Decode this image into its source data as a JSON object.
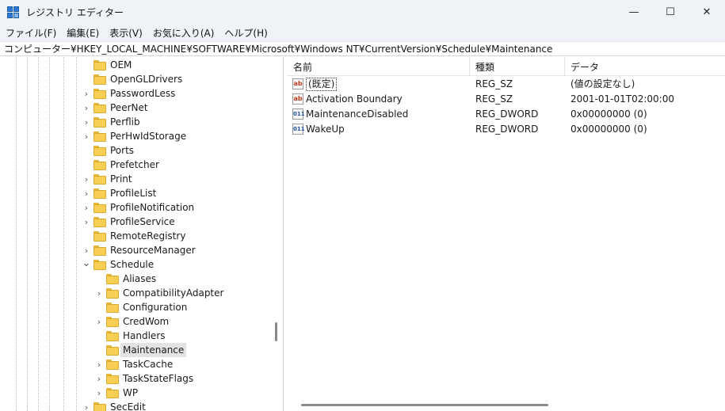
{
  "window": {
    "title": "レジストリ エディター",
    "controls": {
      "minimize": "—",
      "maximize": "☐",
      "close": "✕"
    }
  },
  "menu": [
    "ファイル(F)",
    "編集(E)",
    "表示(V)",
    "お気に入り(A)",
    "ヘルプ(H)"
  ],
  "address": "コンピューター¥HKEY_LOCAL_MACHINE¥SOFTWARE¥Microsoft¥Windows NT¥CurrentVersion¥Schedule¥Maintenance",
  "tree": [
    {
      "label": "OEM",
      "level": 0,
      "chevron": "none"
    },
    {
      "label": "OpenGLDrivers",
      "level": 0,
      "chevron": "none"
    },
    {
      "label": "PasswordLess",
      "level": 0,
      "chevron": "right"
    },
    {
      "label": "PeerNet",
      "level": 0,
      "chevron": "right"
    },
    {
      "label": "Perflib",
      "level": 0,
      "chevron": "right"
    },
    {
      "label": "PerHwIdStorage",
      "level": 0,
      "chevron": "right"
    },
    {
      "label": "Ports",
      "level": 0,
      "chevron": "none"
    },
    {
      "label": "Prefetcher",
      "level": 0,
      "chevron": "none"
    },
    {
      "label": "Print",
      "level": 0,
      "chevron": "right"
    },
    {
      "label": "ProfileList",
      "level": 0,
      "chevron": "right"
    },
    {
      "label": "ProfileNotification",
      "level": 0,
      "chevron": "right"
    },
    {
      "label": "ProfileService",
      "level": 0,
      "chevron": "right"
    },
    {
      "label": "RemoteRegistry",
      "level": 0,
      "chevron": "none"
    },
    {
      "label": "ResourceManager",
      "level": 0,
      "chevron": "right"
    },
    {
      "label": "Schedule",
      "level": 0,
      "chevron": "down"
    },
    {
      "label": "Aliases",
      "level": 1,
      "chevron": "none"
    },
    {
      "label": "CompatibilityAdapter",
      "level": 1,
      "chevron": "right"
    },
    {
      "label": "Configuration",
      "level": 1,
      "chevron": "none"
    },
    {
      "label": "CredWom",
      "level": 1,
      "chevron": "right"
    },
    {
      "label": "Handlers",
      "level": 1,
      "chevron": "none"
    },
    {
      "label": "Maintenance",
      "level": 1,
      "chevron": "none",
      "selected": true
    },
    {
      "label": "TaskCache",
      "level": 1,
      "chevron": "right"
    },
    {
      "label": "TaskStateFlags",
      "level": 1,
      "chevron": "right"
    },
    {
      "label": "WP",
      "level": 1,
      "chevron": "right"
    },
    {
      "label": "SecEdit",
      "level": 0,
      "chevron": "right"
    }
  ],
  "list": {
    "columns": [
      "名前",
      "種類",
      "データ"
    ],
    "rows": [
      {
        "icon": "string-value-icon",
        "icon_text": "ab",
        "name": "(既定)",
        "type": "REG_SZ",
        "data": "(値の設定なし)",
        "focused": true
      },
      {
        "icon": "string-value-icon",
        "icon_text": "ab",
        "name": "Activation Boundary",
        "type": "REG_SZ",
        "data": "2001-01-01T02:00:00"
      },
      {
        "icon": "dword-value-icon",
        "icon_text": "011",
        "name": "MaintenanceDisabled",
        "type": "REG_DWORD",
        "data": "0x00000000 (0)"
      },
      {
        "icon": "dword-value-icon",
        "icon_text": "011",
        "name": "WakeUp",
        "type": "REG_DWORD",
        "data": "0x00000000 (0)"
      }
    ]
  }
}
